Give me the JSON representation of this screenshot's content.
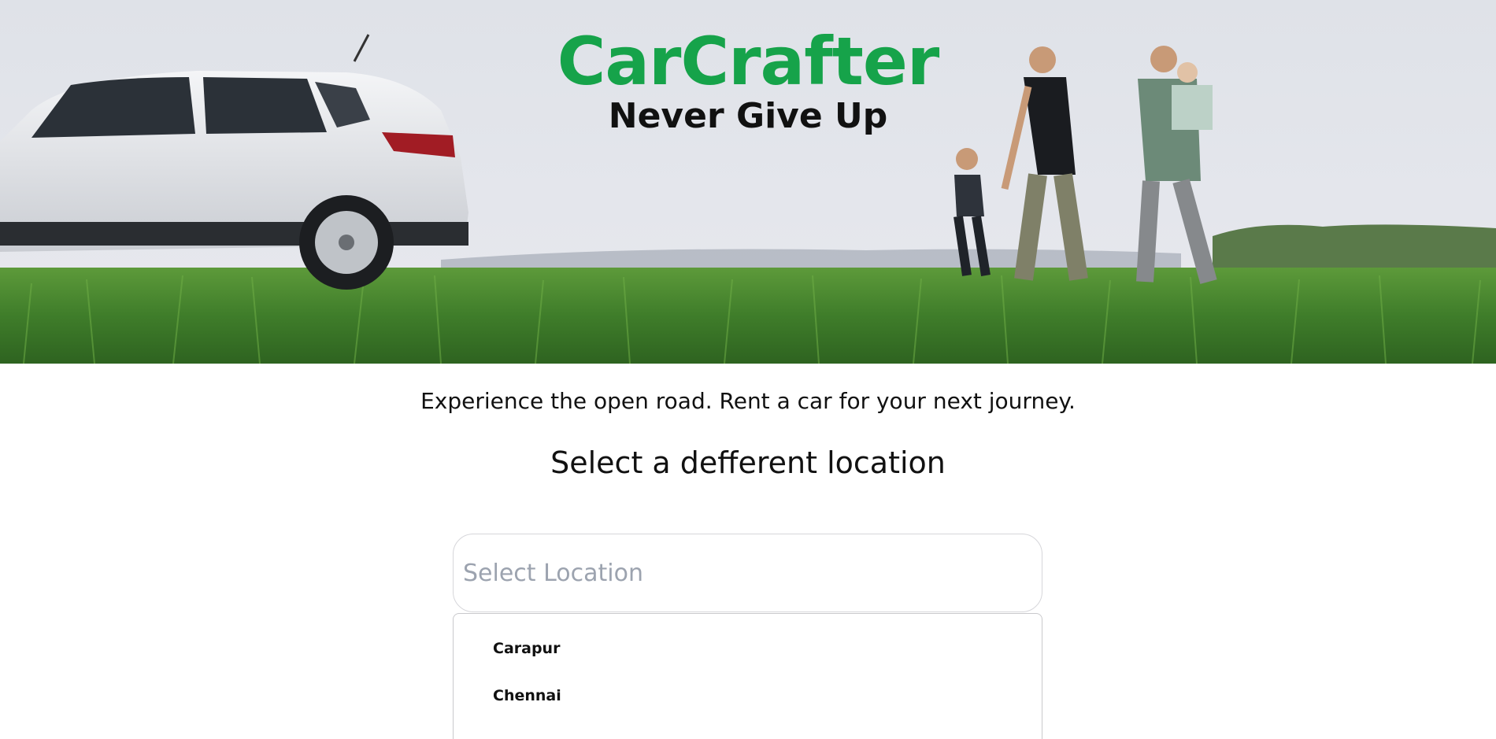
{
  "hero": {
    "brand_name": "CarCrafter",
    "tagline": "Never Give Up"
  },
  "main": {
    "intro": "Experience the open road. Rent a car for your next journey.",
    "heading": "Select a defferent location"
  },
  "location_select": {
    "placeholder": "Select Location",
    "options": [
      "Carapur",
      "Chennai"
    ]
  },
  "colors": {
    "brand": "#16a34a",
    "grass": "#3f7d2a"
  }
}
